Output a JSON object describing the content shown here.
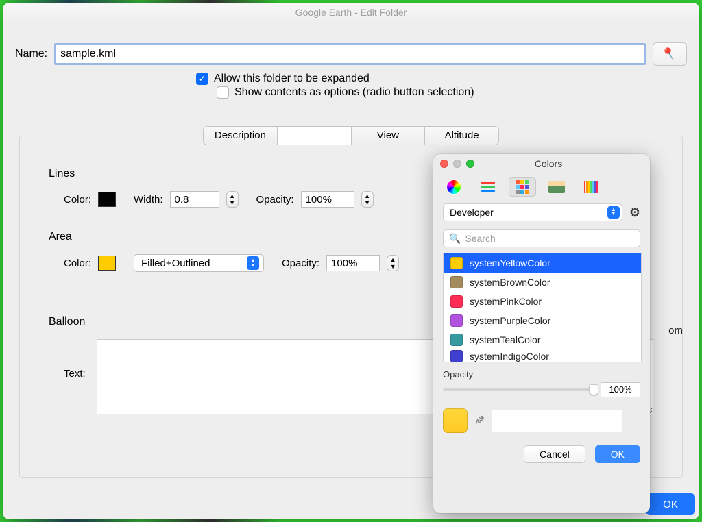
{
  "window": {
    "title": "Google Earth - Edit Folder"
  },
  "name": {
    "label": "Name:",
    "value": "sample.kml"
  },
  "options": {
    "allow_expand": {
      "checked": true,
      "label": "Allow this folder to be expanded"
    },
    "show_radio": {
      "checked": false,
      "label": "Show contents as options (radio button selection)"
    }
  },
  "tabs": {
    "description": "Description",
    "blank": "",
    "view": "View",
    "altitude": "Altitude"
  },
  "lines": {
    "title": "Lines",
    "color_label": "Color:",
    "color_value": "#000000",
    "width_label": "Width:",
    "width_value": "0.8",
    "opacity_label": "Opacity:",
    "opacity_value": "100%"
  },
  "area": {
    "title": "Area",
    "color_label": "Color:",
    "color_value": "#ffcc00",
    "fill_label": "Filled+Outlined",
    "opacity_label": "Opacity:",
    "opacity_value": "100%"
  },
  "balloon": {
    "title": "Balloon",
    "text_label": "Text:"
  },
  "hidden_right": {
    "om": "om"
  },
  "main_ok": "OK",
  "colors": {
    "title": "Colors",
    "palette_dropdown": "Developer",
    "search_placeholder": "Search",
    "list": [
      {
        "name": "systemYellowColor",
        "hex": "#ffcc00",
        "selected": true
      },
      {
        "name": "systemBrownColor",
        "hex": "#a38b5d",
        "selected": false
      },
      {
        "name": "systemPinkColor",
        "hex": "#ff2d55",
        "selected": false
      },
      {
        "name": "systemPurpleColor",
        "hex": "#af52de",
        "selected": false
      },
      {
        "name": "systemTealColor",
        "hex": "#379aa0",
        "selected": false
      },
      {
        "name": "systemIndigoColor",
        "hex": "#4040d0",
        "selected": false
      }
    ],
    "opacity_label": "Opacity",
    "opacity_value": "100%",
    "cancel": "Cancel",
    "ok": "OK"
  }
}
